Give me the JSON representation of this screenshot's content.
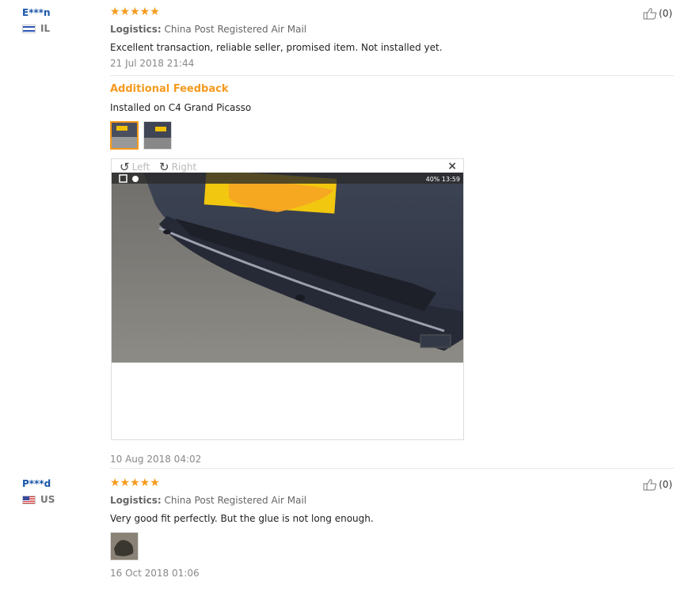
{
  "reviews": [
    {
      "user": "E***n",
      "country": "IL",
      "stars": "★★★★★",
      "logistics_label": "Logistics:",
      "logistics_value": "China Post Registered Air Mail",
      "text": "Excellent transaction, reliable seller, promised item. Not installed yet.",
      "date": "21 Jul 2018 21:44",
      "helpful_count": "(0)",
      "additional": {
        "title": "Additional Feedback",
        "text": "Installed on C4 Grand Picasso",
        "date": "10 Aug 2018 04:02"
      }
    },
    {
      "user": "P***d",
      "country": "US",
      "stars": "★★★★★",
      "logistics_label": "Logistics:",
      "logistics_value": "China Post Registered Air Mail",
      "text": "Very good fit perfectly. But the glue is not long enough.",
      "date": "16 Oct 2018 01:06",
      "helpful_count": "(0)"
    }
  ],
  "viewer": {
    "rotate_left": "Left",
    "rotate_right": "Right",
    "close": "×",
    "status": "40%  13:59"
  },
  "icons": {
    "thumbs_up": "thumbs-up-icon",
    "rotate_left": "rotate-left-icon",
    "rotate_right": "rotate-right-icon",
    "close": "close-icon"
  },
  "colors": {
    "accent": "#f59a1d",
    "username": "#1a56a8"
  }
}
